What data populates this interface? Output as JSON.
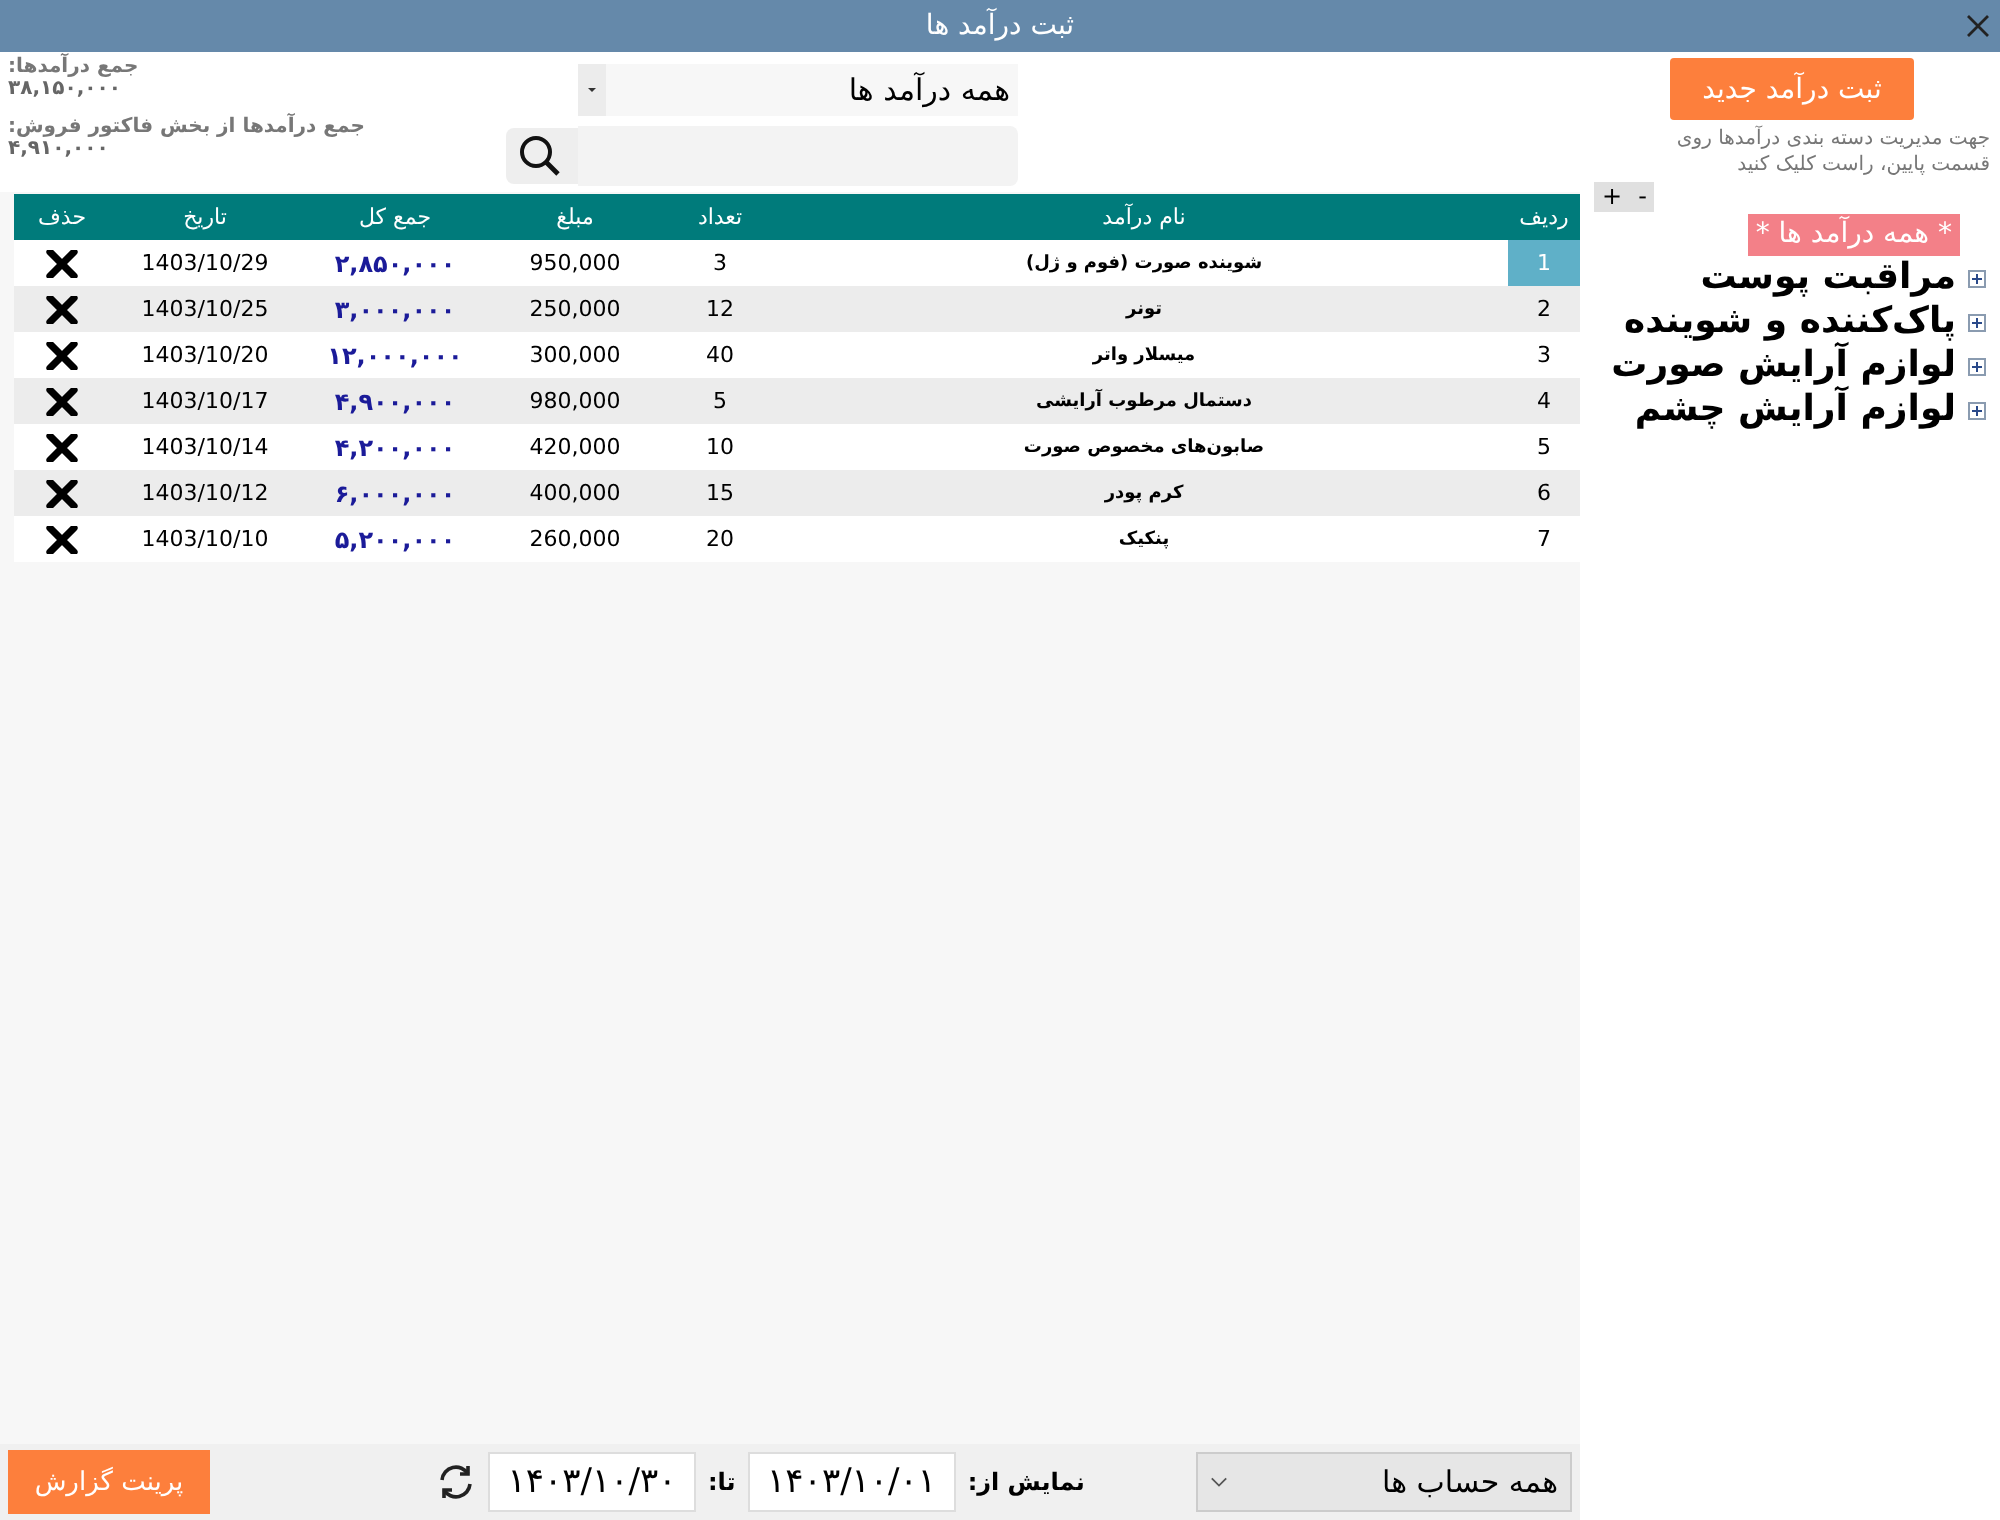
{
  "window": {
    "title": "ثبت درآمد ها"
  },
  "totals": [
    {
      "label": "جمع درآمدها:",
      "value": "۳۸,۱۵۰,۰۰۰"
    },
    {
      "label": "جمع درآمدها از بخش فاکتور فروش:",
      "value": "۴,۹۱۰,۰۰۰"
    }
  ],
  "category_filter": {
    "value": "همه درآمد ها"
  },
  "table": {
    "columns": [
      "ردیف",
      "نام درآمد",
      "تعداد",
      "مبلغ",
      "جمع کل",
      "تاریخ",
      "حذف"
    ],
    "rows": [
      {
        "number": "1",
        "name": "شوینده صورت (فوم و ژل)",
        "quantity": "3",
        "price": "950,000",
        "total": "۲,۸۵۰,۰۰۰",
        "date": "1403/10/29",
        "selected": true
      },
      {
        "number": "2",
        "name": "تونر",
        "quantity": "12",
        "price": "250,000",
        "total": "۳,۰۰۰,۰۰۰",
        "date": "1403/10/25",
        "selected": false
      },
      {
        "number": "3",
        "name": "میسلار واتر",
        "quantity": "40",
        "price": "300,000",
        "total": "۱۲,۰۰۰,۰۰۰",
        "date": "1403/10/20",
        "selected": false
      },
      {
        "number": "4",
        "name": "دستمال مرطوب آرایشی",
        "quantity": "5",
        "price": "980,000",
        "total": "۴,۹۰۰,۰۰۰",
        "date": "1403/10/17",
        "selected": false
      },
      {
        "number": "5",
        "name": "صابون‌های مخصوص صورت",
        "quantity": "10",
        "price": "420,000",
        "total": "۴,۲۰۰,۰۰۰",
        "date": "1403/10/14",
        "selected": false
      },
      {
        "number": "6",
        "name": "کرم پودر",
        "quantity": "15",
        "price": "400,000",
        "total": "۶,۰۰۰,۰۰۰",
        "date": "1403/10/12",
        "selected": false
      },
      {
        "number": "7",
        "name": "پنکیک",
        "quantity": "20",
        "price": "260,000",
        "total": "۵,۲۰۰,۰۰۰",
        "date": "1403/10/10",
        "selected": false
      }
    ]
  },
  "new_button": "ثبت درآمد جدید",
  "hint": "جهت مدیریت دسته بندی درآمدها روی قسمت پایین، راست کلیک کنید",
  "tree_buttons": [
    "-",
    "+"
  ],
  "tree": [
    {
      "label": "* همه درآمد ها *",
      "selected": true,
      "children": [
        {
          "label": "مراقبت پوست",
          "expanded": false,
          "selected": false
        },
        {
          "label": "پاک‌کننده و شوینده",
          "expanded": false,
          "selected": false
        },
        {
          "label": "لوازم آرایش صورت",
          "expanded": false,
          "selected": false
        },
        {
          "label": "لوازم آرایش چشم",
          "expanded": false,
          "selected": false
        }
      ]
    }
  ],
  "print_button": "پرینت گزارش",
  "date_range": {
    "from_label": "نمایش از:",
    "from": "۱۴۰۳/۱۰/۰۱",
    "to_label": "تا:",
    "to": "۱۴۰۳/۱۰/۳۰"
  },
  "account_filter": {
    "value": "همه حساب ها"
  }
}
